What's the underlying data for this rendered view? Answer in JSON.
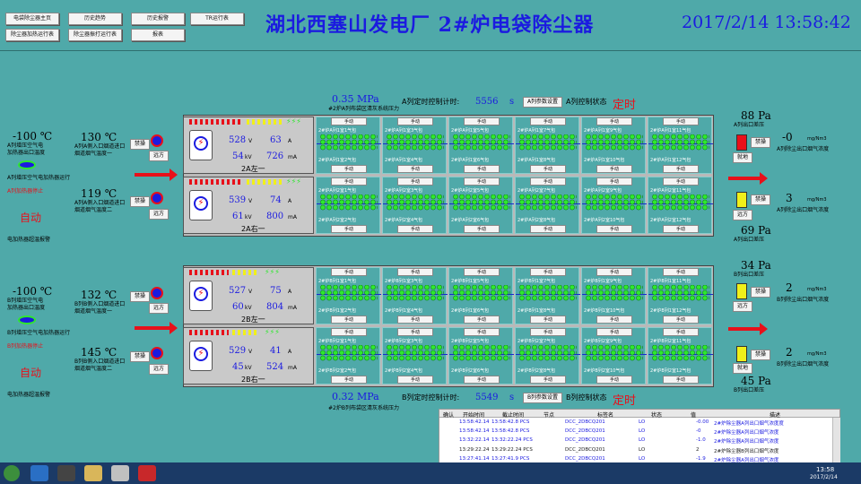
{
  "nav": [
    "电袋除尘器主页",
    "历史趋势",
    "历史报警",
    "TR运行表",
    "除尘器加热运行表",
    "除尘器振打运行表",
    "报表"
  ],
  "title": "湖北西塞山发电厂 2#炉电袋除尘器",
  "datetime": "2017/2/14    13:58:42",
  "left": {
    "a_top_temp": "-100 ℃",
    "a_top_lbl": [
      "A列增压空气电",
      "加热器出口温度"
    ],
    "a_heater_lbl": "A列增压空气电加热器运行",
    "a_heater_state": "A列加热器停止",
    "a_manual": "自动",
    "a_alarm": "电加热器超温报警",
    "a_in1": "130 ℃",
    "a_in1_lbl": [
      "A列A侧入口烟道进口",
      "烟道烟气温度一"
    ],
    "a_in2": "119 ℃",
    "a_in2_lbl": [
      "A列A侧入口烟道进口",
      "烟道烟气温度二"
    ],
    "b_top_temp": "-100 ℃",
    "b_top_lbl": [
      "B列增压空气电",
      "加热器出口温度"
    ],
    "b_heater_lbl": "B列增压空气电加热器运行",
    "b_heater_state": "B列加热器停止",
    "b_manual": "自动",
    "b_alarm": "电加热器超温报警",
    "b_in1": "132 ℃",
    "b_in1_lbl": [
      "B列B侧入口烟道进口",
      "烟道烟气温度一"
    ],
    "b_in2": "145 ℃",
    "b_in2_lbl": [
      "B列B侧入口烟道进口",
      "烟道烟气温度二"
    ]
  },
  "ctrl": {
    "jin": "禁操",
    "yuan": "远方",
    "jiu": "就地"
  },
  "a_mid": {
    "press": "0.35 MPa",
    "press_lbl": "#2炉A列布袋区清灰系统压力",
    "timer_lbl": "A列定时控制计时:",
    "timer": "5556",
    "timer_unit": "s",
    "set_btn": "A列参数设置",
    "mode_lbl": "A列控制状态",
    "mode": "定时"
  },
  "b_mid": {
    "press": "0.32 MPa",
    "press_lbl": "#2炉B列布袋区清灰系统压力",
    "timer_lbl": "B列定时控制计时:",
    "timer": "5549",
    "timer_unit": "s",
    "set_btn": "B列参数设置",
    "mode_lbl": "B列控制状态",
    "mode": "定时"
  },
  "tr": [
    {
      "v": "528",
      "vu": "V",
      "i": "63",
      "iu": "A",
      "kv": "54",
      "kvu": "kV",
      "ma": "726",
      "mau": "mA",
      "name": "2A左一"
    },
    {
      "v": "539",
      "vu": "V",
      "i": "74",
      "iu": "A",
      "kv": "61",
      "kvu": "kV",
      "ma": "800",
      "mau": "mA",
      "name": "2A右一"
    },
    {
      "v": "527",
      "vu": "V",
      "i": "75",
      "iu": "A",
      "kv": "60",
      "kvu": "kV",
      "ma": "804",
      "mau": "mA",
      "name": "2B左一"
    },
    {
      "v": "529",
      "vu": "V",
      "i": "41",
      "iu": "A",
      "kv": "45",
      "kvu": "kV",
      "ma": "524",
      "mau": "mA",
      "name": "2B右一"
    }
  ],
  "manual": "手动",
  "cells": {
    "r1": [
      "2#炉A列1室1气包",
      "2#炉A列1室3气包",
      "2#炉A列1室5气包",
      "2#炉A列1室7气包",
      "2#炉A列1室9气包",
      "2#炉A列1室11气包"
    ],
    "r1b": [
      "2#炉A列1室2气包",
      "2#炉A列1室4气包",
      "2#炉A列1室6气包",
      "2#炉A列1室8气包",
      "2#炉A列1室10气包",
      "2#炉A列1室12气包"
    ],
    "r2": [
      "2#炉A列2室1气包",
      "2#炉A列2室3气包",
      "2#炉A列2室5气包",
      "2#炉A列2室7气包",
      "2#炉A列2室9气包",
      "2#炉A列2室11气包"
    ],
    "r2b": [
      "2#炉A列2室2气包",
      "2#炉A列2室4气包",
      "2#炉A列2室6气包",
      "2#炉A列2室8气包",
      "2#炉A列2室10气包",
      "2#炉A列2室12气包"
    ],
    "r3": [
      "2#炉B列1室1气包",
      "2#炉B列1室3气包",
      "2#炉B列1室5气包",
      "2#炉B列1室7气包",
      "2#炉B列1室9气包",
      "2#炉B列1室11气包"
    ],
    "r3b": [
      "2#炉B列1室2气包",
      "2#炉B列1室4气包",
      "2#炉B列1室6气包",
      "2#炉B列1室8气包",
      "2#炉B列1室10气包",
      "2#炉B列1室12气包"
    ],
    "r4": [
      "2#炉B列2室1气包",
      "2#炉B列2室3气包",
      "2#炉B列2室5气包",
      "2#炉B列2室7气包",
      "2#炉B列2室9气包",
      "2#炉B列2室11气包"
    ],
    "r4b": [
      "2#炉B列2室2气包",
      "2#炉B列2室4气包",
      "2#炉B列2室6气包",
      "2#炉B列2室8气包",
      "2#炉B列2室10气包",
      "2#炉B列2室12气包"
    ]
  },
  "right": {
    "a_dp1": "88 Pa",
    "a_dp1_lbl": "A列出口差压",
    "a_dp2": "69 Pa",
    "a_dp2_lbl": "A列出口差压",
    "a_dust1": "-0",
    "a_dust1_u": "mg/Nm3",
    "a_dust1_lbl": "A列除尘出口烟气浓度",
    "a_dust2": "3",
    "a_dust2_u": "mg/Nm3",
    "a_dust2_lbl": "A列除尘出口烟气浓度",
    "b_dp1": "34 Pa",
    "b_dp1_lbl": "B列出口差压",
    "b_dp2": "45 Pa",
    "b_dp2_lbl": "B列出口差压",
    "b_dust1": "2",
    "b_dust1_u": "mg/Nm3",
    "b_dust1_lbl": "B列除尘出口烟气浓度",
    "b_dust2": "2",
    "b_dust2_u": "mg/Nm3",
    "b_dust2_lbl": "B列除尘出口烟气浓度"
  },
  "alarm": {
    "cols": [
      "确认",
      "开始时间",
      "截止时间",
      "节点",
      "标签名",
      "状态",
      "值",
      "描述"
    ],
    "rows": [
      {
        "start": "13:58:42.14",
        "end": "13:58:42.8 PCS",
        "node": "DCC_2DBCQ201",
        "tag": "",
        "state": "LO",
        "val": "-0.00",
        "desc": "2#炉除尘器A列出口烟气浓度度"
      },
      {
        "start": "13:58:42.14",
        "end": "13:58:42.8 PCS",
        "node": "DCC_2DBCQ201",
        "tag": "",
        "state": "LO",
        "val": "-0",
        "desc": "2#炉除尘器A列出口烟气浓度"
      },
      {
        "start": "13:32:22.14",
        "end": "13:32:22.24 PCS",
        "node": "DCC_2DBCQ201",
        "tag": "",
        "state": "LO",
        "val": "-1.0",
        "desc": "2#炉除尘器A列出口烟气浓度"
      },
      {
        "start": "13:29:22.24",
        "end": "13:29:22.24 PCS",
        "node": "DCC_2DBCQ201",
        "tag": "",
        "state": "LO",
        "val": "2",
        "desc": "2#炉除尘器B列出口烟气浓度"
      },
      {
        "start": "13:27:41.14",
        "end": "13:27:41.9 PCS",
        "node": "DCC_2DBCQ201",
        "tag": "",
        "state": "LO",
        "val": "-1.9",
        "desc": "2#炉除尘器A列出口烟气浓度"
      }
    ]
  },
  "taskbar": {
    "time": "13:58",
    "date": "2017/2/14"
  }
}
